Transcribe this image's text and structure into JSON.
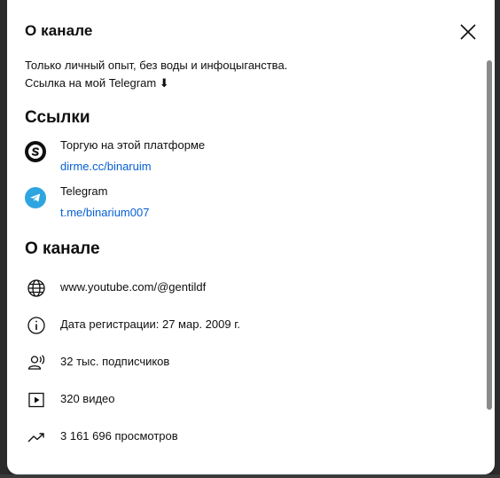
{
  "dialog": {
    "title": "О канале",
    "close_icon": "close-icon"
  },
  "description": {
    "line1": "Только личный опыт, без воды и инфоцыганства.",
    "line2": "Ссылка на мой Telegram ⬇"
  },
  "links": {
    "heading": "Ссылки",
    "items": [
      {
        "name": "Торгую на этой платформе",
        "url": "dirme.cc/binaruim",
        "icon": "platform-logo-icon",
        "icon_color": "#0f0f0f"
      },
      {
        "name": "Telegram",
        "url": "t.me/binarium007",
        "icon": "telegram-icon",
        "icon_color": "#2ca5e0"
      }
    ]
  },
  "about": {
    "heading": "О канале",
    "items": [
      {
        "icon": "globe-icon",
        "text": "www.youtube.com/@gentildf"
      },
      {
        "icon": "info-icon",
        "text": "Дата регистрации: 27 мар. 2009 г."
      },
      {
        "icon": "subscribers-icon",
        "text": "32 тыс. подписчиков"
      },
      {
        "icon": "video-icon",
        "text": "320 видео"
      },
      {
        "icon": "trending-icon",
        "text": "3 161 696 просмотров"
      }
    ]
  },
  "colors": {
    "link": "#065fd4",
    "text": "#0f0f0f",
    "background": "#ffffff"
  }
}
